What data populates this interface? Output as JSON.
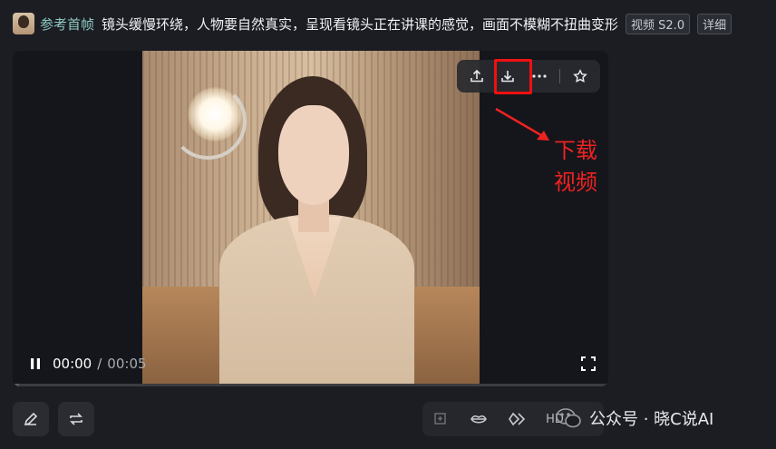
{
  "prompt": {
    "ref_label": "参考首帧",
    "text": "镜头缓慢环绕，人物要自然真实，呈现看镜头正在讲课的感觉，画面不模糊不扭曲变形",
    "tags": [
      "视频 S2.0",
      "详细"
    ]
  },
  "player": {
    "current_time": "00:00",
    "separator": "/",
    "total_time": "00:05",
    "progress": 0.0
  },
  "hover_toolbar": {
    "icons": [
      "upload-icon",
      "download-icon",
      "more-icon",
      "star-icon"
    ]
  },
  "annotation": {
    "text": "下载视频",
    "color": "#ee2222"
  },
  "bottom_tools": {
    "hd_label": "HD"
  },
  "watermark": {
    "text": "公众号 · 晓C说AI"
  }
}
